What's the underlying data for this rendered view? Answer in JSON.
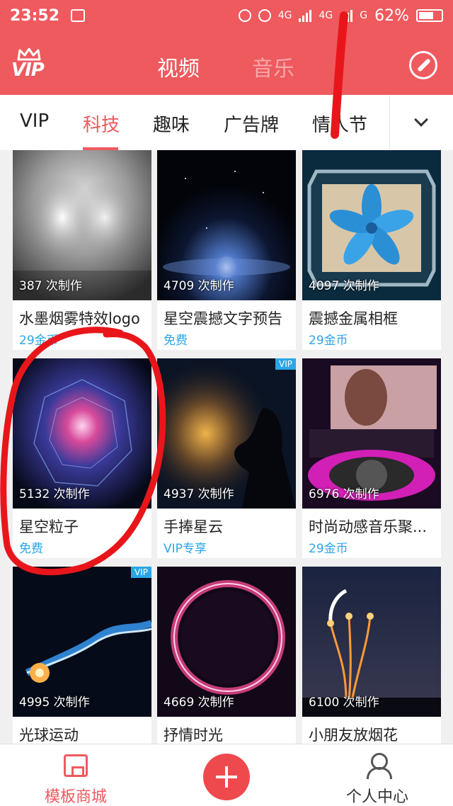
{
  "status_bar": {
    "time": "23:52",
    "network_1": "4G",
    "network_2": "4G",
    "network_3": "G",
    "battery": "62%"
  },
  "header": {
    "logo_text": "VIP",
    "tabs": [
      {
        "label": "视频",
        "active": true
      },
      {
        "label": "音乐",
        "active": false
      }
    ],
    "compass_icon": "compass-icon"
  },
  "categories": {
    "items": [
      "VIP",
      "科技",
      "趣味",
      "广告牌",
      "情人节"
    ],
    "active": "科技",
    "more_icon": "chevron-down-icon"
  },
  "templates": [
    {
      "count": "387 次制作",
      "title": "水墨烟雾特效logo",
      "price": "29金币",
      "vip": false
    },
    {
      "count": "4709 次制作",
      "title": "星空震撼文字预告",
      "price": "免费",
      "vip": false
    },
    {
      "count": "4097 次制作",
      "title": "震撼金属相框",
      "price": "29金币",
      "vip": false
    },
    {
      "count": "5132 次制作",
      "title": "星空粒子",
      "price": "免费",
      "vip": false
    },
    {
      "count": "4937 次制作",
      "title": "手捧星云",
      "price": "VIP专享",
      "vip": true,
      "badge": "VIP"
    },
    {
      "count": "6976 次制作",
      "title": "时尚动感音乐聚...",
      "price": "29金币",
      "vip": false
    },
    {
      "count": "4995 次制作",
      "title": "光球运动",
      "price": "",
      "vip": true,
      "badge": "VIP"
    },
    {
      "count": "4669 次制作",
      "title": "抒情时光",
      "price": "",
      "vip": false
    },
    {
      "count": "6100 次制作",
      "title": "小朋友放烟花",
      "price": "",
      "vip": false
    }
  ],
  "bottom_nav": {
    "home_label": "模板商城",
    "create_icon": "plus-icon",
    "profile_label": "个人中心"
  },
  "colors": {
    "brand_red": "#ee5a5e",
    "accent_blue": "#2aa6e6",
    "annotation_red": "#e8161b"
  }
}
